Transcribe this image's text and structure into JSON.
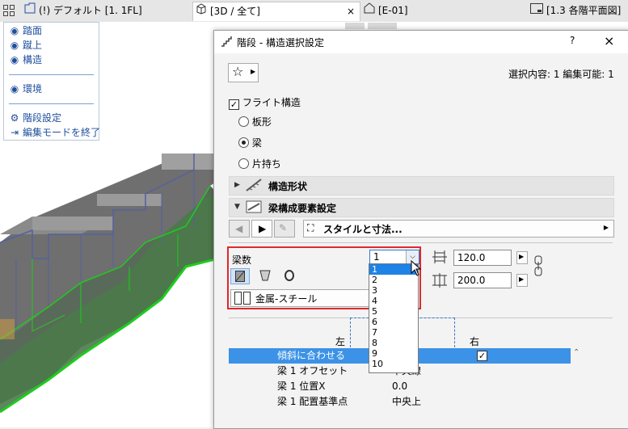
{
  "tabs": {
    "tab1": "(!) デフォルト [1. 1FL]",
    "tab2": "[3D / 全て]",
    "tab2_close": "×",
    "tab3": "[E-01]",
    "tab4": "[1.3 各階平面図]"
  },
  "sidemenu": {
    "items": [
      "踏面",
      "蹴上",
      "構造",
      "環境",
      "階段設定",
      "編集モードを終了"
    ]
  },
  "dialog": {
    "title": "階段 - 構造選択設定",
    "help": "?",
    "close": "×",
    "selection_info": "選択内容: 1 編集可能: 1",
    "flight_structure_label": "フライト構造",
    "structure_options": [
      {
        "label": "板形",
        "selected": false
      },
      {
        "label": "梁",
        "selected": true
      },
      {
        "label": "片持ち",
        "selected": false
      }
    ],
    "section_structure_shape": "構造形状",
    "section_beam_elements": "梁構成要素設定",
    "style_dimension_label": "スタイルと寸法...",
    "beam_count_label": "梁数",
    "beam_count_value": "1",
    "beam_count_options": [
      "1",
      "2",
      "3",
      "4",
      "5",
      "6",
      "7",
      "8",
      "9",
      "10"
    ],
    "width_value": "120.0",
    "height_value": "200.0",
    "material_label": "金属-スチール",
    "left_label": "左",
    "right_label": "右",
    "table": [
      {
        "name": "傾斜に合わせる",
        "value": "",
        "checked": true,
        "selected": true
      },
      {
        "name": "梁 1 オフセット",
        "value": "中央線",
        "selected": false
      },
      {
        "name": "梁 1 位置X",
        "value": "0.0",
        "selected": false
      },
      {
        "name": "梁 1 配置基準点",
        "value": "中央上",
        "selected": false
      }
    ]
  },
  "colors": {
    "accent_select": "#1e82e6",
    "highlight_box": "#e0282d",
    "link_blue": "#1f4e9c",
    "beam_green": "#1ecc1e"
  }
}
